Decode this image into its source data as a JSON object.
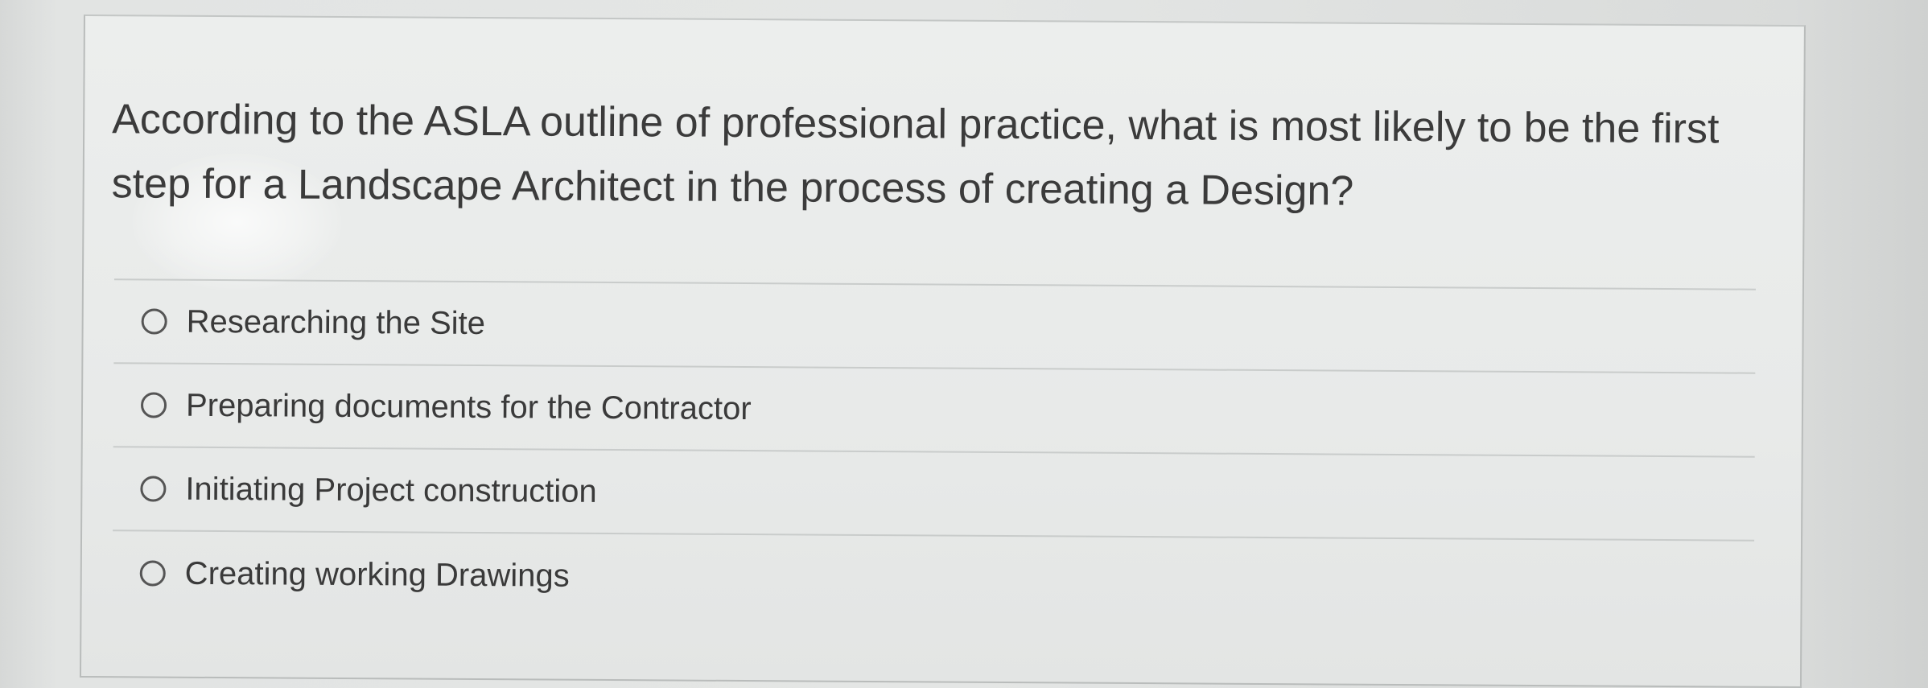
{
  "question": {
    "text": "According to the ASLA outline of professional practice, what is most likely to be the first step for a Landscape Architect in the process of creating a Design?"
  },
  "options": [
    {
      "label": "Researching the Site",
      "selected": false
    },
    {
      "label": "Preparing documents for the Contractor",
      "selected": false
    },
    {
      "label": "Initiating Project construction",
      "selected": false
    },
    {
      "label": "Creating working Drawings",
      "selected": false
    }
  ],
  "colors": {
    "text": "#3b3b3b",
    "divider": "#c9cccb",
    "radio_border": "#555555"
  }
}
